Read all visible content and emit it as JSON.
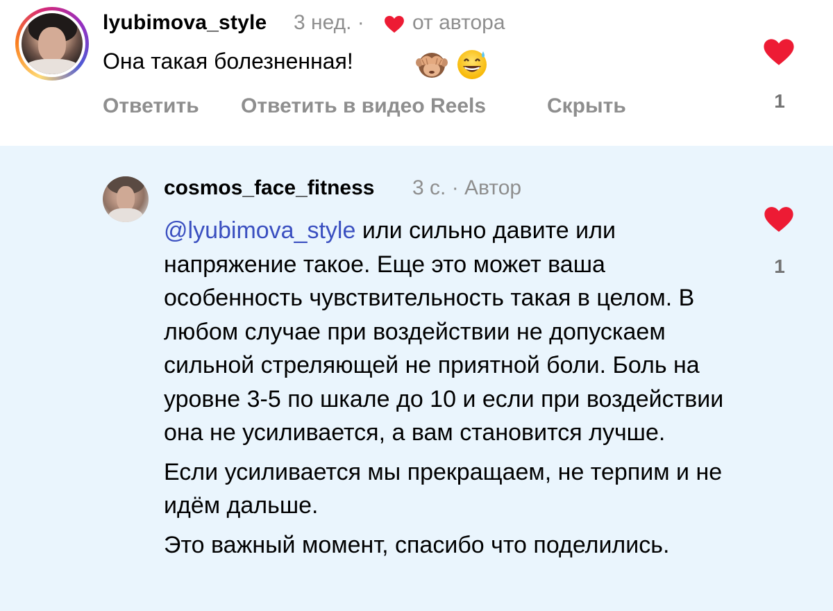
{
  "colors": {
    "like_red": "#ed1b34",
    "meta_gray": "#8e8e8e",
    "mention_blue": "#3a4fc0",
    "reply_bg": "#eaf5fd"
  },
  "top_comment": {
    "username": "lyubimova_style",
    "time": "3 нед. ·",
    "author_liked_icon": "heart-icon",
    "author_liked_label": "от автора",
    "text": "Она такая болезненная!",
    "emojis": [
      "see-no-evil-monkey-emoji",
      "grinning-sweat-emoji"
    ],
    "actions": {
      "reply": "Ответить",
      "reply_reels": "Ответить в видео Reels",
      "hide": "Скрыть"
    },
    "like_icon": "heart-icon",
    "like_count": "1"
  },
  "reply_comment": {
    "username": "cosmos_face_fitness",
    "meta": "3 с. · Автор",
    "mention": "@lyubimova_style",
    "paragraph1_rest": " или сильно давите или напряжение такое. Еще это может ваша особенность чувствительность такая в целом. В любом случае при воздействии не допускаем сильной стреляющей не приятной боли. Боль на уровне 3-5 по шкале до 10 и если при воздействии она не усиливается, а вам становится лучше.",
    "paragraph2": "Если усиливается мы прекращаем, не терпим и не идём дальше.",
    "paragraph3": "Это важный момент, спасибо что поделились.",
    "like_icon": "heart-icon",
    "like_count": "1"
  }
}
